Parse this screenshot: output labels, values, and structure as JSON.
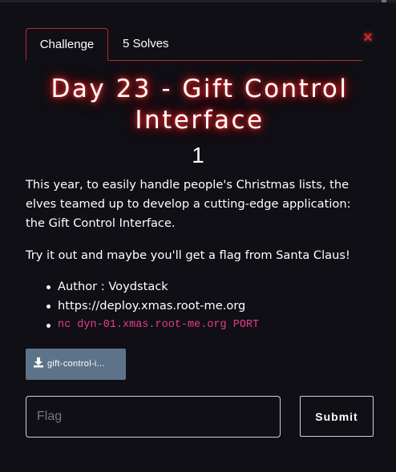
{
  "tabs": {
    "challenge": "Challenge",
    "solves": "5 Solves"
  },
  "close_icon": "×",
  "challenge": {
    "title": "Day 23 - Gift Control Interface",
    "points": "1",
    "description": "This year, to easily handle people's Christmas lists, the elves teamed up to develop a cutting-edge application: the Gift Control Interface.",
    "prompt": "Try it out and maybe you'll get a flag from Santa Claus!",
    "details": [
      "Author : Voydstack",
      "https://deploy.xmas.root-me.org",
      "nc dyn-01.xmas.root-me.org PORT"
    ],
    "file": {
      "icon": "download-icon",
      "label": "gift-control-i..."
    }
  },
  "form": {
    "flag_placeholder": "Flag",
    "flag_value": "",
    "submit_label": "Submit"
  },
  "colors": {
    "accent": "#b52a2a",
    "close": "#d32a2a",
    "code": "#e83e8c",
    "download_button": "#5d7389",
    "background": "#0f0f15"
  }
}
